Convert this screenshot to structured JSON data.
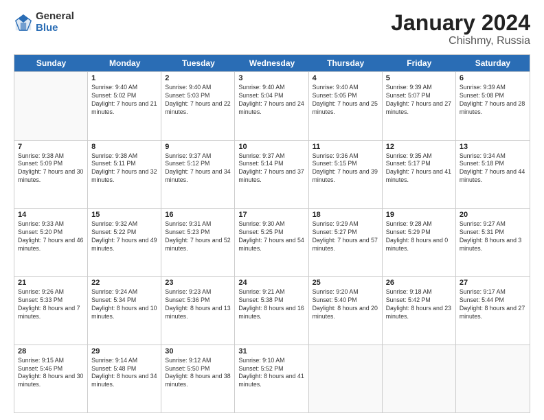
{
  "logo": {
    "general": "General",
    "blue": "Blue"
  },
  "title": {
    "month": "January 2024",
    "location": "Chishmy, Russia"
  },
  "weekdays": [
    "Sunday",
    "Monday",
    "Tuesday",
    "Wednesday",
    "Thursday",
    "Friday",
    "Saturday"
  ],
  "rows": [
    [
      {
        "day": "",
        "sunrise": "",
        "sunset": "",
        "daylight": ""
      },
      {
        "day": "1",
        "sunrise": "Sunrise: 9:40 AM",
        "sunset": "Sunset: 5:02 PM",
        "daylight": "Daylight: 7 hours and 21 minutes."
      },
      {
        "day": "2",
        "sunrise": "Sunrise: 9:40 AM",
        "sunset": "Sunset: 5:03 PM",
        "daylight": "Daylight: 7 hours and 22 minutes."
      },
      {
        "day": "3",
        "sunrise": "Sunrise: 9:40 AM",
        "sunset": "Sunset: 5:04 PM",
        "daylight": "Daylight: 7 hours and 24 minutes."
      },
      {
        "day": "4",
        "sunrise": "Sunrise: 9:40 AM",
        "sunset": "Sunset: 5:05 PM",
        "daylight": "Daylight: 7 hours and 25 minutes."
      },
      {
        "day": "5",
        "sunrise": "Sunrise: 9:39 AM",
        "sunset": "Sunset: 5:07 PM",
        "daylight": "Daylight: 7 hours and 27 minutes."
      },
      {
        "day": "6",
        "sunrise": "Sunrise: 9:39 AM",
        "sunset": "Sunset: 5:08 PM",
        "daylight": "Daylight: 7 hours and 28 minutes."
      }
    ],
    [
      {
        "day": "7",
        "sunrise": "Sunrise: 9:38 AM",
        "sunset": "Sunset: 5:09 PM",
        "daylight": "Daylight: 7 hours and 30 minutes."
      },
      {
        "day": "8",
        "sunrise": "Sunrise: 9:38 AM",
        "sunset": "Sunset: 5:11 PM",
        "daylight": "Daylight: 7 hours and 32 minutes."
      },
      {
        "day": "9",
        "sunrise": "Sunrise: 9:37 AM",
        "sunset": "Sunset: 5:12 PM",
        "daylight": "Daylight: 7 hours and 34 minutes."
      },
      {
        "day": "10",
        "sunrise": "Sunrise: 9:37 AM",
        "sunset": "Sunset: 5:14 PM",
        "daylight": "Daylight: 7 hours and 37 minutes."
      },
      {
        "day": "11",
        "sunrise": "Sunrise: 9:36 AM",
        "sunset": "Sunset: 5:15 PM",
        "daylight": "Daylight: 7 hours and 39 minutes."
      },
      {
        "day": "12",
        "sunrise": "Sunrise: 9:35 AM",
        "sunset": "Sunset: 5:17 PM",
        "daylight": "Daylight: 7 hours and 41 minutes."
      },
      {
        "day": "13",
        "sunrise": "Sunrise: 9:34 AM",
        "sunset": "Sunset: 5:18 PM",
        "daylight": "Daylight: 7 hours and 44 minutes."
      }
    ],
    [
      {
        "day": "14",
        "sunrise": "Sunrise: 9:33 AM",
        "sunset": "Sunset: 5:20 PM",
        "daylight": "Daylight: 7 hours and 46 minutes."
      },
      {
        "day": "15",
        "sunrise": "Sunrise: 9:32 AM",
        "sunset": "Sunset: 5:22 PM",
        "daylight": "Daylight: 7 hours and 49 minutes."
      },
      {
        "day": "16",
        "sunrise": "Sunrise: 9:31 AM",
        "sunset": "Sunset: 5:23 PM",
        "daylight": "Daylight: 7 hours and 52 minutes."
      },
      {
        "day": "17",
        "sunrise": "Sunrise: 9:30 AM",
        "sunset": "Sunset: 5:25 PM",
        "daylight": "Daylight: 7 hours and 54 minutes."
      },
      {
        "day": "18",
        "sunrise": "Sunrise: 9:29 AM",
        "sunset": "Sunset: 5:27 PM",
        "daylight": "Daylight: 7 hours and 57 minutes."
      },
      {
        "day": "19",
        "sunrise": "Sunrise: 9:28 AM",
        "sunset": "Sunset: 5:29 PM",
        "daylight": "Daylight: 8 hours and 0 minutes."
      },
      {
        "day": "20",
        "sunrise": "Sunrise: 9:27 AM",
        "sunset": "Sunset: 5:31 PM",
        "daylight": "Daylight: 8 hours and 3 minutes."
      }
    ],
    [
      {
        "day": "21",
        "sunrise": "Sunrise: 9:26 AM",
        "sunset": "Sunset: 5:33 PM",
        "daylight": "Daylight: 8 hours and 7 minutes."
      },
      {
        "day": "22",
        "sunrise": "Sunrise: 9:24 AM",
        "sunset": "Sunset: 5:34 PM",
        "daylight": "Daylight: 8 hours and 10 minutes."
      },
      {
        "day": "23",
        "sunrise": "Sunrise: 9:23 AM",
        "sunset": "Sunset: 5:36 PM",
        "daylight": "Daylight: 8 hours and 13 minutes."
      },
      {
        "day": "24",
        "sunrise": "Sunrise: 9:21 AM",
        "sunset": "Sunset: 5:38 PM",
        "daylight": "Daylight: 8 hours and 16 minutes."
      },
      {
        "day": "25",
        "sunrise": "Sunrise: 9:20 AM",
        "sunset": "Sunset: 5:40 PM",
        "daylight": "Daylight: 8 hours and 20 minutes."
      },
      {
        "day": "26",
        "sunrise": "Sunrise: 9:18 AM",
        "sunset": "Sunset: 5:42 PM",
        "daylight": "Daylight: 8 hours and 23 minutes."
      },
      {
        "day": "27",
        "sunrise": "Sunrise: 9:17 AM",
        "sunset": "Sunset: 5:44 PM",
        "daylight": "Daylight: 8 hours and 27 minutes."
      }
    ],
    [
      {
        "day": "28",
        "sunrise": "Sunrise: 9:15 AM",
        "sunset": "Sunset: 5:46 PM",
        "daylight": "Daylight: 8 hours and 30 minutes."
      },
      {
        "day": "29",
        "sunrise": "Sunrise: 9:14 AM",
        "sunset": "Sunset: 5:48 PM",
        "daylight": "Daylight: 8 hours and 34 minutes."
      },
      {
        "day": "30",
        "sunrise": "Sunrise: 9:12 AM",
        "sunset": "Sunset: 5:50 PM",
        "daylight": "Daylight: 8 hours and 38 minutes."
      },
      {
        "day": "31",
        "sunrise": "Sunrise: 9:10 AM",
        "sunset": "Sunset: 5:52 PM",
        "daylight": "Daylight: 8 hours and 41 minutes."
      },
      {
        "day": "",
        "sunrise": "",
        "sunset": "",
        "daylight": ""
      },
      {
        "day": "",
        "sunrise": "",
        "sunset": "",
        "daylight": ""
      },
      {
        "day": "",
        "sunrise": "",
        "sunset": "",
        "daylight": ""
      }
    ]
  ]
}
